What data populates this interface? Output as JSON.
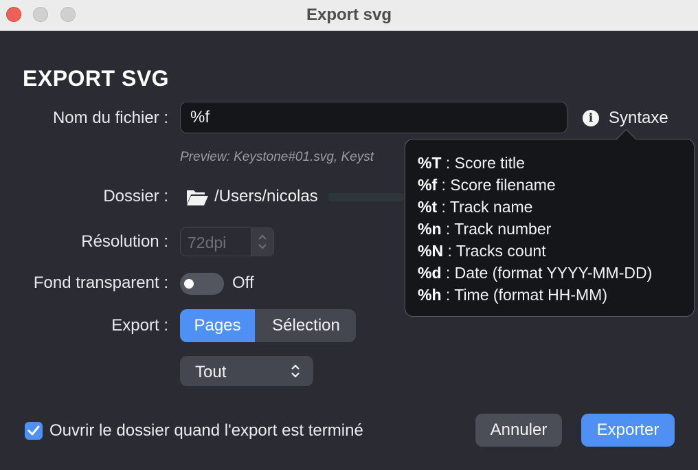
{
  "window": {
    "title": "Export svg"
  },
  "header": {
    "title": "EXPORT SVG"
  },
  "filename": {
    "label": "Nom du fichier :",
    "value": "%f",
    "preview": "Preview: Keystone#01.svg, Keyst"
  },
  "syntax": {
    "label": "Syntaxe",
    "icon": "info-icon"
  },
  "folder": {
    "label": "Dossier :",
    "path": "/Users/nicolas",
    "icon": "folder-open-icon"
  },
  "resolution": {
    "label": "Résolution :",
    "value": "72dpi"
  },
  "transparent": {
    "label": "Fond transparent :",
    "state": "Off"
  },
  "export": {
    "label": "Export :",
    "options": [
      "Pages",
      "Sélection"
    ],
    "selected": "Pages",
    "range": "Tout"
  },
  "open_folder": {
    "label": "Ouvrir le dossier quand l'export est terminé",
    "checked": true
  },
  "buttons": {
    "cancel": "Annuler",
    "export": "Exporter"
  },
  "popover": {
    "items": [
      {
        "code": "%T",
        "desc": " : Score title"
      },
      {
        "code": "%f",
        "desc": " : Score filename"
      },
      {
        "code": "%t",
        "desc": " : Track name"
      },
      {
        "code": "%n",
        "desc": " : Track number"
      },
      {
        "code": "%N",
        "desc": " : Tracks count"
      },
      {
        "code": "%d",
        "desc": " : Date (format YYYY-MM-DD)"
      },
      {
        "code": "%h",
        "desc": " : Time (format HH-MM)"
      }
    ]
  },
  "colors": {
    "accent": "#4e90f4",
    "background": "#2b2c33"
  }
}
